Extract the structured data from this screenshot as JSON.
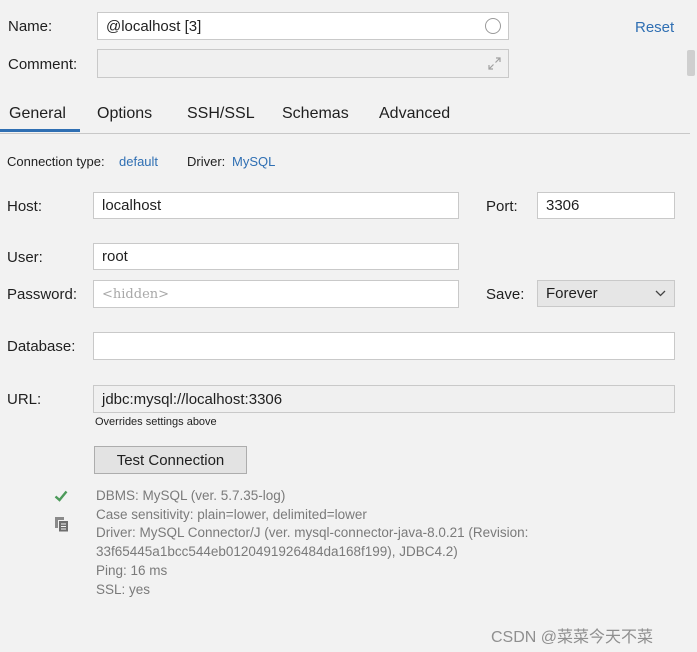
{
  "header": {
    "name_label": "Name:",
    "name_value": "@localhost [3]",
    "comment_label": "Comment:",
    "comment_value": "",
    "reset_label": "Reset"
  },
  "tabs": [
    {
      "label": "General",
      "active": true
    },
    {
      "label": "Options",
      "active": false
    },
    {
      "label": "SSH/SSL",
      "active": false
    },
    {
      "label": "Schemas",
      "active": false
    },
    {
      "label": "Advanced",
      "active": false
    }
  ],
  "connection": {
    "type_label": "Connection type:",
    "type_value": "default",
    "driver_label": "Driver:",
    "driver_value": "MySQL"
  },
  "form": {
    "host_label": "Host:",
    "host_value": "localhost",
    "port_label": "Port:",
    "port_value": "3306",
    "user_label": "User:",
    "user_value": "root",
    "password_label": "Password:",
    "password_placeholder": "<hidden>",
    "save_label": "Save:",
    "save_value": "Forever",
    "database_label": "Database:",
    "database_value": "",
    "url_label": "URL:",
    "url_value": "jdbc:mysql://localhost:3306",
    "url_note": "Overrides settings above"
  },
  "test": {
    "button_label": "Test Connection",
    "results": [
      "DBMS: MySQL (ver. 5.7.35-log)",
      "Case sensitivity: plain=lower, delimited=lower",
      "Driver: MySQL Connector/J (ver. mysql-connector-java-8.0.21 (Revision:",
      "33f65445a1bcc544eb0120491926484da168f199), JDBC4.2)",
      "Ping: 16 ms",
      "SSL: yes"
    ]
  },
  "watermark": "CSDN @菜菜今天不菜",
  "colors": {
    "link": "#2f6fb3",
    "success": "#4c9a5a",
    "tab_underline": "#2f6fb3"
  }
}
